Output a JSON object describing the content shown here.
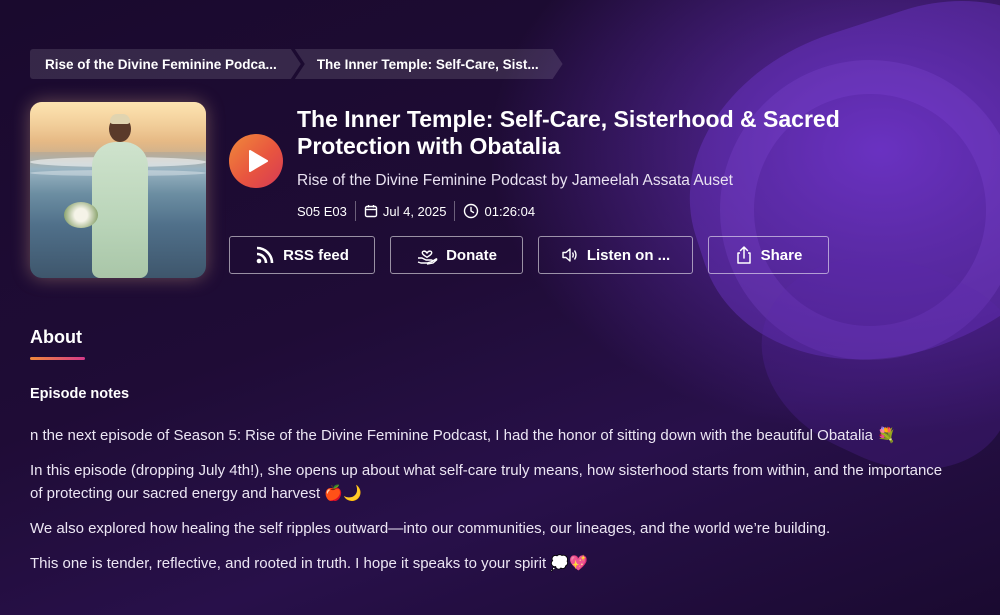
{
  "breadcrumb": {
    "items": [
      {
        "label": "Rise of the Divine Feminine Podca..."
      },
      {
        "label": "The Inner Temple: Self-Care, Sist..."
      }
    ]
  },
  "cover": {
    "icon": "podcast-cover-image"
  },
  "player": {
    "icon": "play-icon",
    "accent": "#e8553f"
  },
  "episode": {
    "title": "The Inner Temple: Self-Care, Sisterhood & Sacred Protection with Obatalia",
    "show": "Rise of the Divine Feminine Podcast by Jameelah Assata Auset",
    "season_episode": "S05 E03",
    "date": "Jul 4, 2025",
    "duration": "01:26:04"
  },
  "actions": {
    "rss": {
      "label": "RSS feed",
      "icon": "rss-icon"
    },
    "donate": {
      "label": "Donate",
      "icon": "donate-hand-heart-icon"
    },
    "listen": {
      "label": "Listen on ...",
      "icon": "speaker-icon"
    },
    "share": {
      "label": "Share",
      "icon": "share-icon"
    }
  },
  "about": {
    "tab_label": "About",
    "notes_heading": "Episode notes",
    "paragraphs": [
      "n the next episode of Season 5: Rise of the Divine Feminine Podcast, I had the honor of sitting down with the beautiful Obatalia 💐",
      "In this episode (dropping July 4th!), she opens up about what self-care truly means, how sisterhood starts from within, and the importance of protecting our sacred energy and harvest 🍎🌙",
      "We also explored how healing the self ripples outward—into our communities, our lineages, and the world we’re building.",
      "This one is tender, reflective, and rooted in truth. I hope it speaks to your spirit 💭💖"
    ]
  },
  "colors": {
    "background": "#1e0c33",
    "accent_gradient_start": "#f08a3a",
    "accent_gradient_end": "#d63a55"
  }
}
